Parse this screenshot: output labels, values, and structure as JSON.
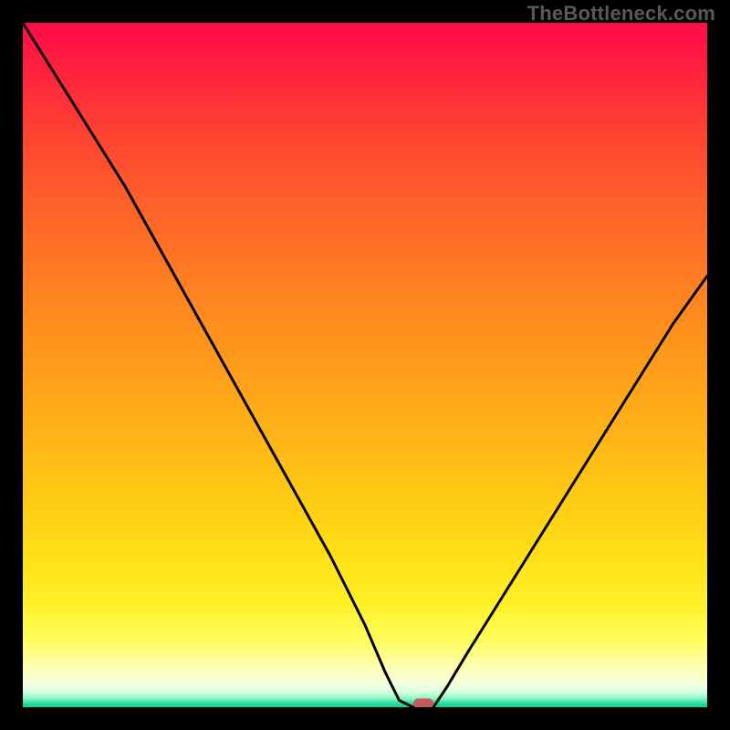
{
  "watermark": "TheBottleneck.com",
  "colors": {
    "frame": "#000000",
    "curve": "#000000",
    "marker": "#c65a56",
    "gradient_top": "#ff0b49",
    "gradient_bottom": "#11d596"
  },
  "chart_data": {
    "type": "line",
    "title": "",
    "xlabel": "",
    "ylabel": "",
    "xlim": [
      0,
      100
    ],
    "ylim": [
      0,
      100
    ],
    "annotations": [
      "TheBottleneck.com"
    ],
    "series": [
      {
        "name": "curve",
        "x": [
          0,
          5,
          10,
          15,
          20,
          25,
          30,
          35,
          40,
          45,
          50,
          53,
          55,
          57,
          60,
          62,
          65,
          70,
          75,
          80,
          85,
          90,
          95,
          100
        ],
        "values": [
          100,
          92,
          84,
          76,
          67,
          58,
          49,
          40,
          31,
          22,
          12,
          5,
          1,
          0,
          0,
          3,
          8,
          16,
          24,
          32,
          40,
          48,
          56,
          63
        ]
      }
    ],
    "marker": {
      "x": 58.5,
      "y": 0
    },
    "background_gradient": [
      {
        "stop": 0.0,
        "color": "#ff0b49"
      },
      {
        "stop": 0.5,
        "color": "#ffb317"
      },
      {
        "stop": 0.9,
        "color": "#fffd5a"
      },
      {
        "stop": 0.97,
        "color": "#eaffe3"
      },
      {
        "stop": 1.0,
        "color": "#11d596"
      }
    ]
  }
}
